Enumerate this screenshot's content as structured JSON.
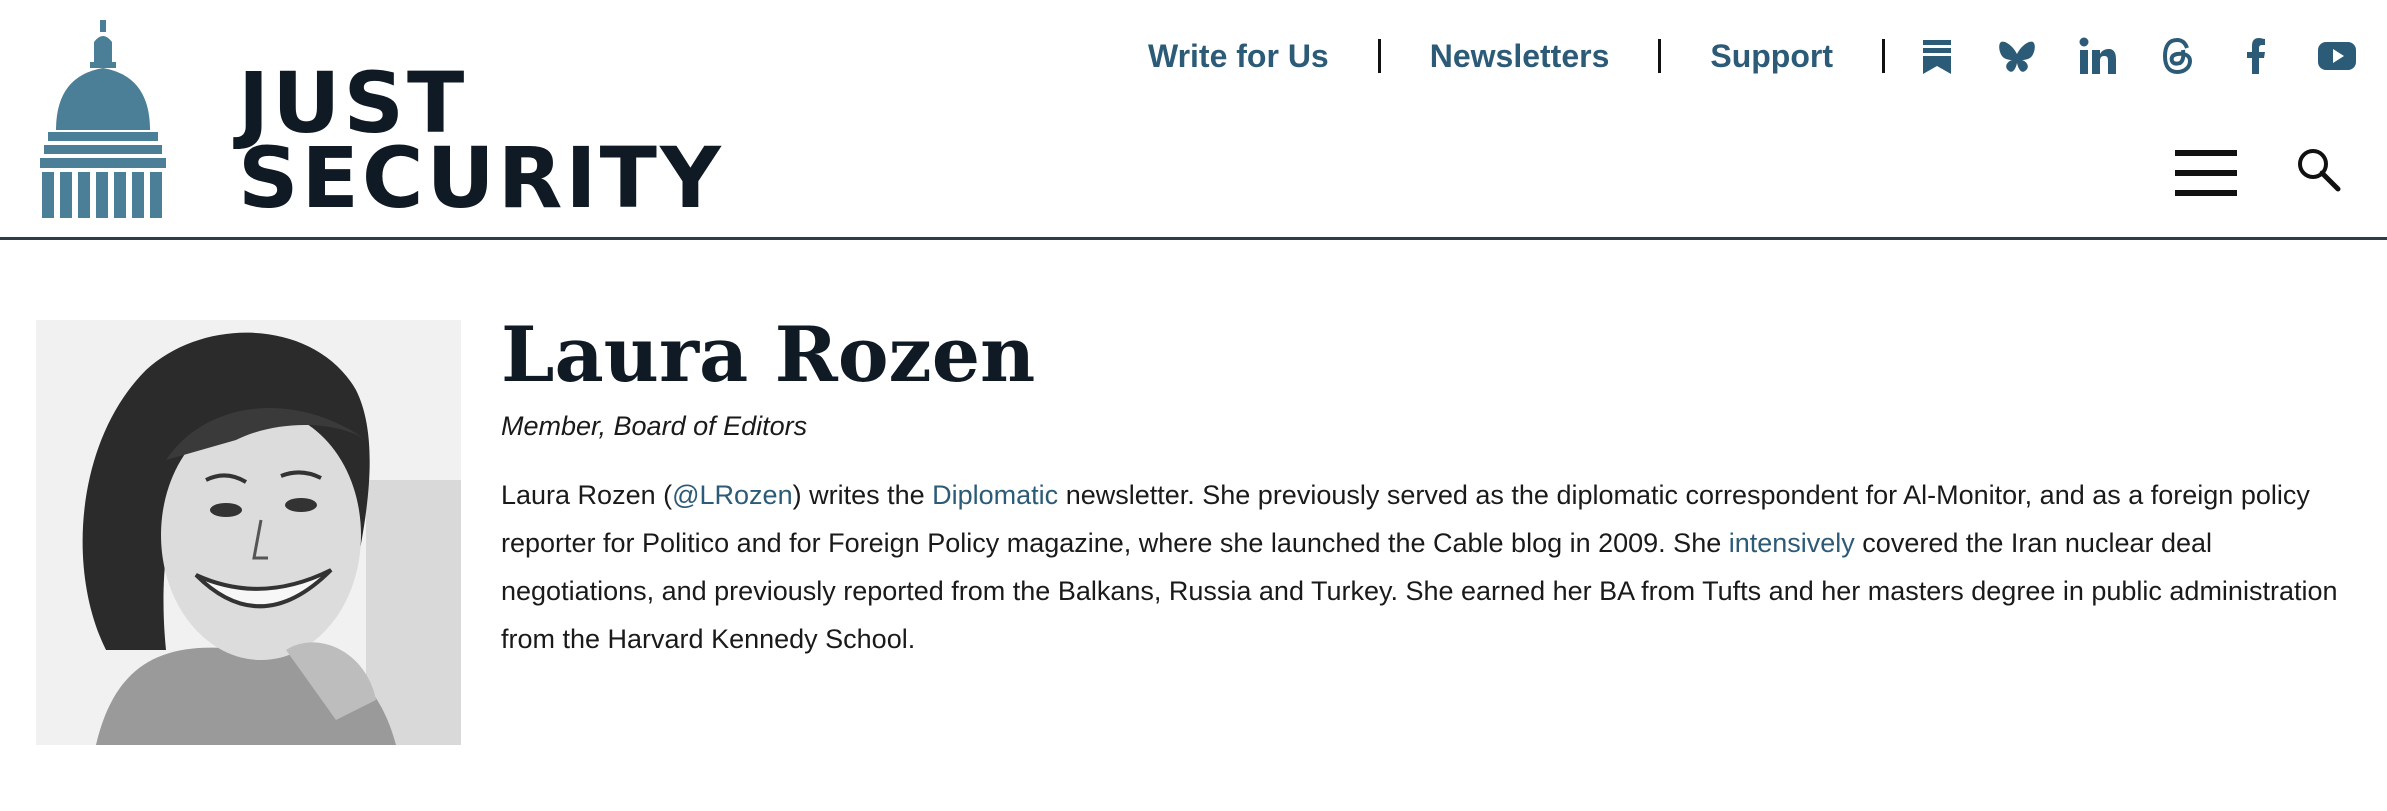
{
  "header": {
    "logo": {
      "line1": "JUST",
      "line2": "SECURITY"
    },
    "nav": [
      {
        "label": "Write for Us"
      },
      {
        "label": "Newsletters"
      },
      {
        "label": "Support"
      }
    ],
    "social_icons": [
      "substack-icon",
      "bluesky-icon",
      "linkedin-icon",
      "threads-icon",
      "facebook-icon",
      "youtube-icon"
    ],
    "menu_icon": "hamburger-menu-icon",
    "search_icon": "search-icon"
  },
  "author": {
    "name": "Laura Rozen",
    "role": "Member, Board of Editors",
    "bio": {
      "t1": "Laura Rozen (",
      "link_handle": "@LRozen",
      "t2": ") writes the ",
      "link_newsletter": "Diplomatic",
      "t3": " newsletter. She previously served as the diplomatic correspondent for Al-Monitor, and as a foreign policy reporter for Politico and for Foreign Policy magazine, where she launched the Cable blog in 2009. She ",
      "link_intensively": "intensively",
      "t4": " covered the Iran nuclear deal negotiations, and previously reported from the Balkans, Russia and Turkey. She earned her BA from Tufts and her masters degree in public administration from the Harvard Kennedy School."
    }
  },
  "colors": {
    "brand": "#4a7f97",
    "link": "#2c5b77",
    "dark": "#0f1a24"
  }
}
